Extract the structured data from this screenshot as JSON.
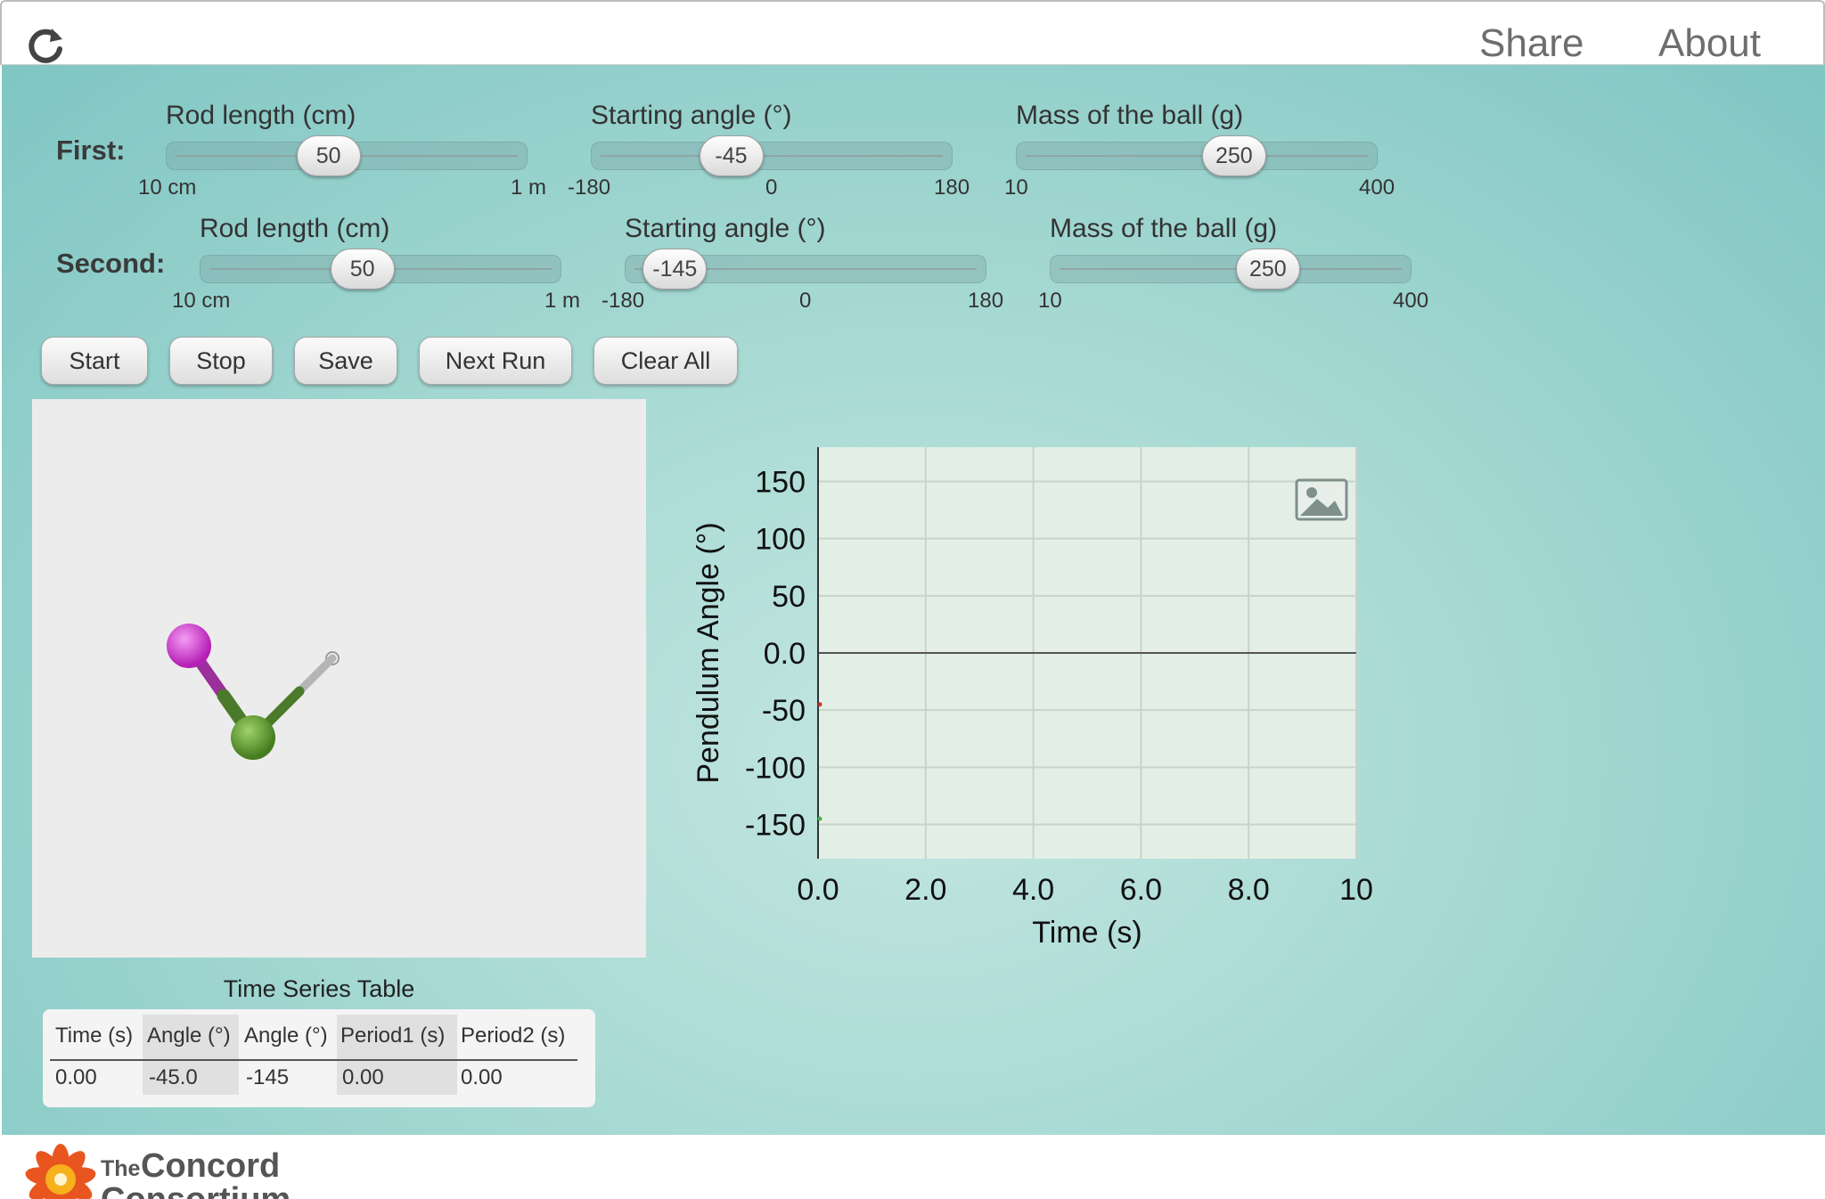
{
  "header": {
    "share_label": "Share",
    "about_label": "About",
    "reload_icon": "reload-icon"
  },
  "controls": {
    "first": {
      "label": "First:",
      "rod_length": {
        "title": "Rod length (cm)",
        "value": "50",
        "min_label": "10 cm",
        "max_label": "1 m",
        "fraction": 0.444
      },
      "starting_angle": {
        "title": "Starting angle (°)",
        "value": "-45",
        "min_label": "-180",
        "mid_label": "0",
        "max_label": "180",
        "fraction": 0.375
      },
      "mass": {
        "title": "Mass of the ball (g)",
        "value": "250",
        "min_label": "10",
        "max_label": "400",
        "fraction": 0.615
      }
    },
    "second": {
      "label": "Second:",
      "rod_length": {
        "title": "Rod length (cm)",
        "value": "50",
        "min_label": "10 cm",
        "max_label": "1 m",
        "fraction": 0.444
      },
      "starting_angle": {
        "title": "Starting angle (°)",
        "value": "-145",
        "min_label": "-180",
        "mid_label": "0",
        "max_label": "180",
        "fraction": 0.097
      },
      "mass": {
        "title": "Mass of the ball (g)",
        "value": "250",
        "min_label": "10",
        "max_label": "400",
        "fraction": 0.615
      }
    }
  },
  "buttons": {
    "start": "Start",
    "stop": "Stop",
    "save": "Save",
    "next_run": "Next Run",
    "clear_all": "Clear All"
  },
  "simulation": {
    "pendulum1_color": "#c83cc8",
    "pendulum2_color": "#5a9a2e"
  },
  "chart_data": {
    "type": "line",
    "xlabel": "Time (s)",
    "ylabel": "Pendulum Angle (°)",
    "xlim": [
      0,
      10
    ],
    "ylim": [
      -180,
      180
    ],
    "x_ticks": [
      "0.0",
      "2.0",
      "4.0",
      "6.0",
      "8.0",
      "10"
    ],
    "x_tick_values": [
      0,
      2,
      4,
      6,
      8,
      10
    ],
    "y_ticks": [
      "150",
      "100",
      "50",
      "0.0",
      "-50",
      "-100",
      "-150"
    ],
    "y_tick_values": [
      150,
      100,
      50,
      0,
      -50,
      -100,
      -150
    ],
    "grid": true,
    "series": [
      {
        "x": [
          0
        ],
        "y": [
          -45
        ],
        "color": "#c0392b"
      },
      {
        "x": [
          0
        ],
        "y": [
          -145
        ],
        "color": "#4caf50"
      }
    ],
    "export_icon": "image-export-icon"
  },
  "table": {
    "title": "Time Series Table",
    "headers": [
      "Time (s)",
      "Angle (°)",
      "Angle (°)",
      "Period1 (s)",
      "Period2 (s)"
    ],
    "rows": [
      [
        "0.00",
        "-45.0",
        "-145",
        "0.00",
        "0.00"
      ]
    ]
  },
  "footer": {
    "logo_text_small": "The",
    "logo_text_line1": "Concord",
    "logo_text_line2": "Consortium"
  }
}
